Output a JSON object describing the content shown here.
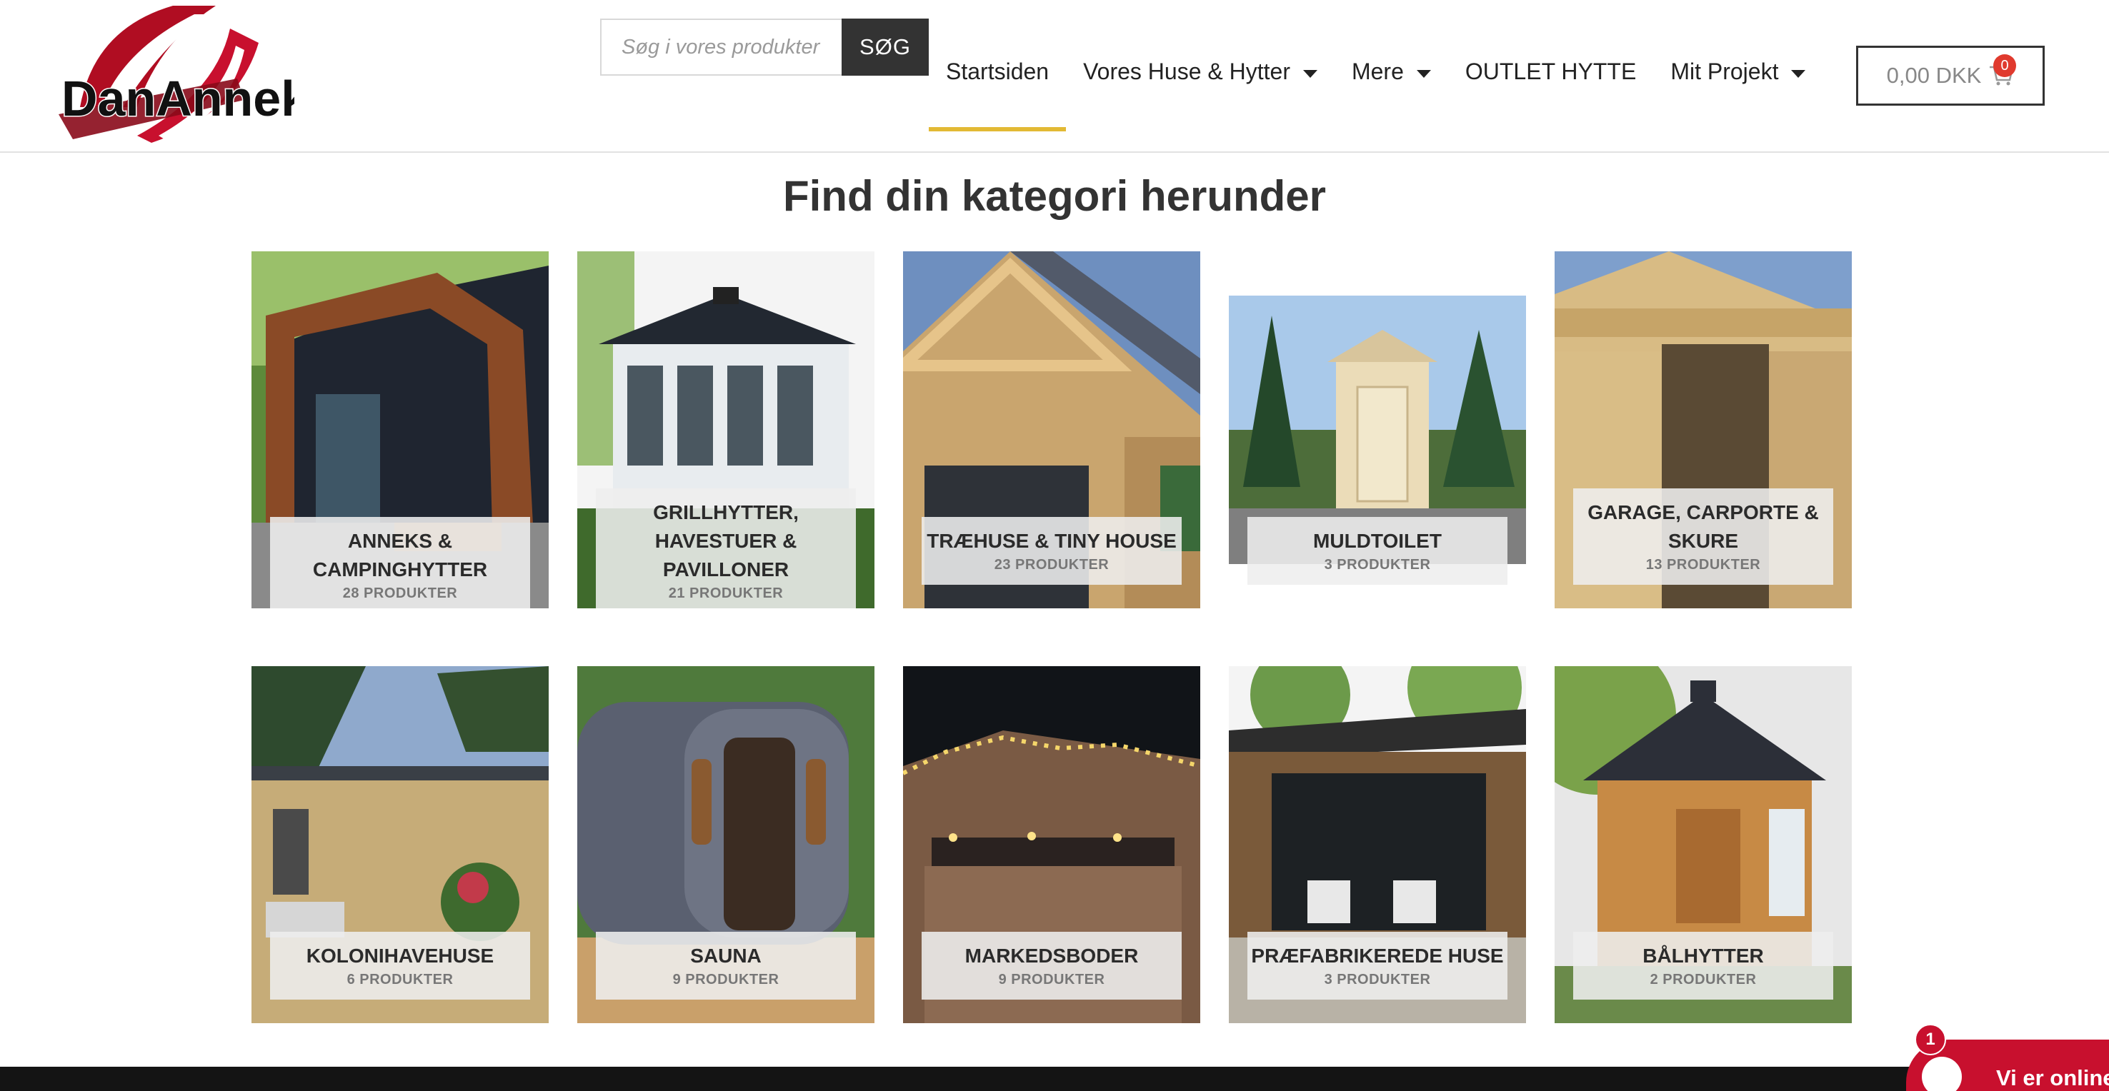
{
  "header": {
    "logo_text": "DanAnneks",
    "search": {
      "placeholder": "Søg i vores produkter",
      "button_label": "SØG"
    },
    "nav": {
      "home": "Startsiden",
      "houses": "Vores Huse & Hytter",
      "more": "Mere",
      "outlet": "OUTLET HYTTE",
      "project": "Mit Projekt"
    },
    "cart": {
      "total": "0,00 DKK",
      "count": "0"
    }
  },
  "main": {
    "title": "Find din kategori herunder",
    "categories": [
      {
        "name": "ANNEKS & CAMPINGHYTTER",
        "count": "28 PRODUKTER"
      },
      {
        "name": "GRILLHYTTER, HAVESTUER & PAVILLONER",
        "count": "21 PRODUKTER"
      },
      {
        "name": "TRÆHUSE & TINY HOUSE",
        "count": "23 PRODUKTER"
      },
      {
        "name": "MULDTOILET",
        "count": "3 PRODUKTER"
      },
      {
        "name": "GARAGE, CARPORTE & SKURE",
        "count": "13 PRODUKTER"
      },
      {
        "name": "KOLONIHAVEHUSE",
        "count": "6 PRODUKTER"
      },
      {
        "name": "SAUNA",
        "count": "9 PRODUKTER"
      },
      {
        "name": "MARKEDSBODER",
        "count": "9 PRODUKTER"
      },
      {
        "name": "PRÆFABRIKEREDE HUSE",
        "count": "3 PRODUKTER"
      },
      {
        "name": "BÅLHYTTER",
        "count": "2 PRODUKTER"
      }
    ]
  },
  "chat": {
    "text": "Vi er online",
    "badge": "1"
  },
  "colors": {
    "accent": "#e2b934",
    "brand_red": "#c8102e",
    "dark": "#333333"
  }
}
